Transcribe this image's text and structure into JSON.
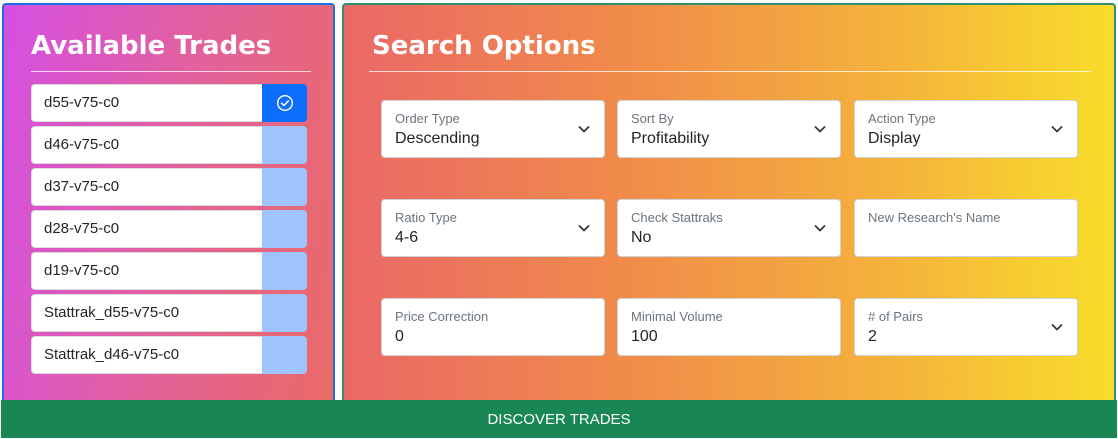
{
  "available_trades": {
    "title": "Available Trades",
    "items": [
      {
        "label": "d55-v75-c0",
        "selected": true
      },
      {
        "label": "d46-v75-c0",
        "selected": false
      },
      {
        "label": "d37-v75-c0",
        "selected": false
      },
      {
        "label": "d28-v75-c0",
        "selected": false
      },
      {
        "label": "d19-v75-c0",
        "selected": false
      },
      {
        "label": "Stattrak_d55-v75-c0",
        "selected": false
      },
      {
        "label": "Stattrak_d46-v75-c0",
        "selected": false
      }
    ]
  },
  "search_options": {
    "title": "Search Options",
    "fields": {
      "order_type": {
        "label": "Order Type",
        "value": "Descending"
      },
      "sort_by": {
        "label": "Sort By",
        "value": "Profitability"
      },
      "action_type": {
        "label": "Action Type",
        "value": "Display"
      },
      "ratio_type": {
        "label": "Ratio Type",
        "value": "4-6"
      },
      "check_stattraks": {
        "label": "Check Stattraks",
        "value": "No"
      },
      "research_name": {
        "label": "New Research's Name",
        "value": ""
      },
      "price_correction": {
        "label": "Price Correction",
        "value": "0"
      },
      "minimal_volume": {
        "label": "Minimal Volume",
        "value": "100"
      },
      "pairs": {
        "label": "# of Pairs",
        "value": "2"
      }
    }
  },
  "discover_button": {
    "label": "Discover Trades"
  },
  "colors": {
    "selected_check": "#0d6efd",
    "unselected_check": "#9fc4fc",
    "discover_button": "#198754"
  }
}
